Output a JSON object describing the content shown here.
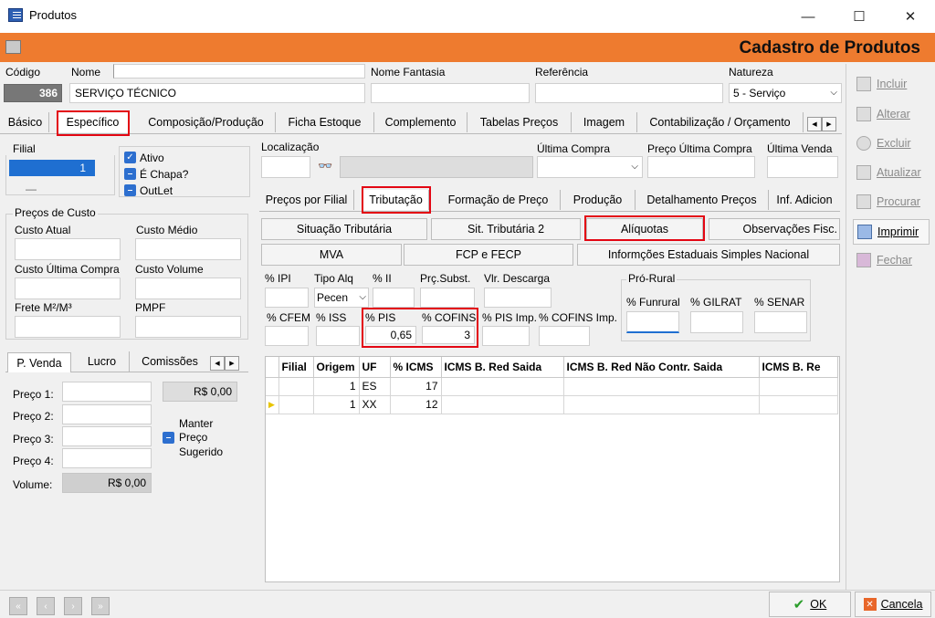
{
  "window": {
    "title": "Produtos",
    "minimize": "—",
    "maximize": "☐",
    "close": "✕"
  },
  "banner": {
    "title": "Cadastro de Produtos"
  },
  "header": {
    "codigo_label": "Código",
    "codigo_value": "386",
    "nome_label": "Nome",
    "nome_value": "SERVIÇO TÉCNICO",
    "fantasia_label": "Nome Fantasia",
    "referencia_label": "Referência",
    "natureza_label": "Natureza",
    "natureza_value": "5 - Serviço"
  },
  "main_tabs": [
    "Básico",
    "Específico",
    "Composição/Produção",
    "Ficha Estoque",
    "Complemento",
    "Tabelas Preços",
    "Imagem",
    "Contabilização / Orçamento"
  ],
  "left": {
    "filial_label": "Filial",
    "filial_value": "1",
    "filial_line": "—",
    "ativo": "Ativo",
    "chapa": "É Chapa?",
    "outlet": "OutLet",
    "precos_custo": "Preços de Custo",
    "custo_atual": "Custo Atual",
    "custo_medio": "Custo Médio",
    "custo_ultima": "Custo Última Compra",
    "custo_volume": "Custo Volume",
    "frete": "Frete M²/M³",
    "pmpf": "PMPF",
    "subtabs": [
      "P. Venda",
      "Lucro",
      "Comissões"
    ],
    "preco1": "Preço 1:",
    "preco2": "Preço 2:",
    "preco3": "Preço 3:",
    "preco4": "Preço 4:",
    "volume": "Volume:",
    "preco1_value": "R$ 0,00",
    "volume_value": "R$ 0,00",
    "manter": "Manter",
    "preco": "Preço",
    "sugerido": "Sugerido"
  },
  "right": {
    "localizacao": "Localização",
    "ultima_compra": "Última Compra",
    "preco_ultima": "Preço Última Compra",
    "ultima_venda": "Última Venda",
    "binoculars": "👓",
    "subtabs": [
      "Preços por Filial",
      "Tributação",
      "Formação de Preço",
      "Produção",
      "Detalhamento Preços",
      "Inf. Adicion"
    ],
    "buttons_row1": [
      "Situação Tributária",
      "Sit. Tributária 2",
      "Alíquotas",
      "Observações Fisc."
    ],
    "buttons_row2": [
      "MVA",
      "FCP e FECP",
      "Informções Estaduais Simples Nacional"
    ],
    "ipi": "% IPI",
    "tipo_alq": "Tipo Alq",
    "tipo_alq_value": "Pecen",
    "ii": "% II",
    "prc_subst": "Prç.Subst.",
    "vlr_descarga": "Vlr. Descarga",
    "pro_rural": "Pró-Rural",
    "funrural": "% Funrural",
    "gilrat": "% GILRAT",
    "senar": "% SENAR",
    "cfem": "% CFEM",
    "iss": "% ISS",
    "pis": "% PIS",
    "pis_value": "0,65",
    "cofins": "% COFINS",
    "cofins_value": "3",
    "pis_imp": "% PIS Imp.",
    "cofins_imp": "% COFINS Imp."
  },
  "grid": {
    "headers": [
      "",
      "Filial",
      "Origem",
      "UF",
      "% ICMS",
      "ICMS B. Red Saida",
      "ICMS B. Red Não Contr. Saida",
      "ICMS B. Re"
    ],
    "rows": [
      {
        "marker": "",
        "filial": "",
        "origem": "1",
        "uf": "ES",
        "icms": "17"
      },
      {
        "marker": "▶",
        "filial": "",
        "origem": "1",
        "uf": "XX",
        "icms": "12"
      }
    ]
  },
  "sidebar": [
    "Incluir",
    "Alterar",
    "Excluir",
    "Atualizar",
    "Procurar",
    "Imprimir",
    "Fechar"
  ],
  "footer": {
    "ok": "OK",
    "cancel": "Cancela",
    "nav": [
      "«",
      "‹",
      "›",
      "»"
    ]
  },
  "colors": {
    "banner": "#ee7b2f",
    "highlight": "#e30613",
    "select": "#1f6fd1"
  }
}
